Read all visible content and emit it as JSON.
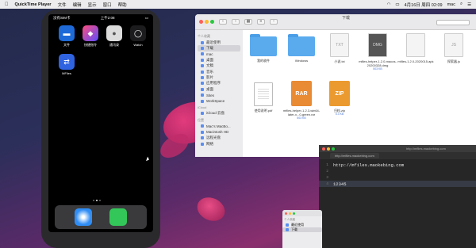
{
  "menubar": {
    "app_name": "QuickTime Player",
    "menus": [
      "文件",
      "编辑",
      "显示",
      "窗口",
      "帮助"
    ],
    "clock": "4月16日 周四 02:09",
    "user": "mac"
  },
  "phone": {
    "status_left": "没有SIM卡",
    "status_time": "上午2:08",
    "apps": [
      {
        "label": "文件",
        "glyph": "▬"
      },
      {
        "label": "快捷指令",
        "glyph": "◆"
      },
      {
        "label": "通讯录",
        "glyph": "●"
      },
      {
        "label": "Watch",
        "glyph": "◯"
      },
      {
        "label": "MFiles",
        "glyph": "⇄"
      }
    ]
  },
  "finder": {
    "title": "下载",
    "sidebar": {
      "favorites_header": "个人收藏",
      "favorites": [
        "最近使用",
        "下载",
        "mac",
        "桌面",
        "文稿",
        "音乐",
        "影片",
        "应用程序",
        "桌面",
        "Sites",
        "WorkSpace"
      ],
      "icloud_header": "iCloud",
      "icloud": [
        "iCloud 云盘"
      ],
      "locations_header": "位置",
      "locations": [
        "Mac's MacBo...",
        "Macintosh HD",
        "远程光盘",
        "网络"
      ]
    },
    "files": [
      {
        "name": "我的收件",
        "sub": "",
        "kind": "folder"
      },
      {
        "name": "Windows",
        "sub": "",
        "kind": "folder"
      },
      {
        "name": "小说.txt",
        "sub": "",
        "kind": "txt",
        "glyph": "TXT"
      },
      {
        "name": "mfiles-helper-1.2.0-macos-20200328.dmg",
        "sub": "503 KB",
        "kind": "dmg",
        "glyph": "DMG"
      },
      {
        "name": "mfiles-1.2.0-2020015.apk",
        "sub": "",
        "kind": "doc",
        "glyph": ""
      },
      {
        "name": "探索器.js",
        "sub": "",
        "kind": "js",
        "glyph": "JS"
      },
      {
        "name": "使用说明.pdf",
        "sub": "",
        "kind": "pdf",
        "glyph": ""
      },
      {
        "name": "mfiles-helper-1.2.3-win64-later-x...0-green.rar",
        "sub": "503 KB",
        "kind": "rar",
        "glyph": "RAR"
      },
      {
        "name": "归档.zip",
        "sub": "5.3 KB",
        "kind": "zip",
        "glyph": "ZIP"
      }
    ]
  },
  "browser": {
    "title": "http://mfiles.maokebing.com",
    "tab_label": "http://mfiles.maokebing.com",
    "lines": [
      {
        "num": "1",
        "text": "http://mfiles.maokebing.com"
      },
      {
        "num": "2",
        "text": ""
      },
      {
        "num": "3",
        "text": ""
      },
      {
        "num": "4",
        "text": "12345"
      }
    ]
  },
  "finder2": {
    "header": "个人收藏",
    "items": [
      "最近使用",
      "下载"
    ]
  }
}
